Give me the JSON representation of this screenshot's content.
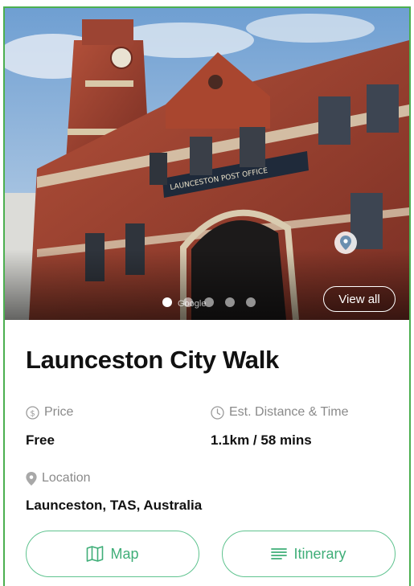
{
  "hero": {
    "sign_text": "LAUNCESTON POST OFFICE",
    "watermark": "Google",
    "view_all_label": "View all",
    "carousel": {
      "count": 5,
      "active_index": 0
    },
    "pin_icon": "location-pin-icon"
  },
  "title": "Launceston City Walk",
  "price": {
    "label": "Price",
    "value": "Free",
    "icon": "dollar-circle-icon"
  },
  "distance": {
    "label": "Est. Distance & Time",
    "value": "1.1km / 58 mins",
    "icon": "clock-icon"
  },
  "location": {
    "label": "Location",
    "value": "Launceston, TAS, Australia",
    "icon": "location-pin-icon"
  },
  "buttons": {
    "map_label": "Map",
    "itinerary_label": "Itinerary"
  },
  "colors": {
    "accent": "#3fae78",
    "border": "#5fc38f",
    "frame": "#4caf50"
  }
}
